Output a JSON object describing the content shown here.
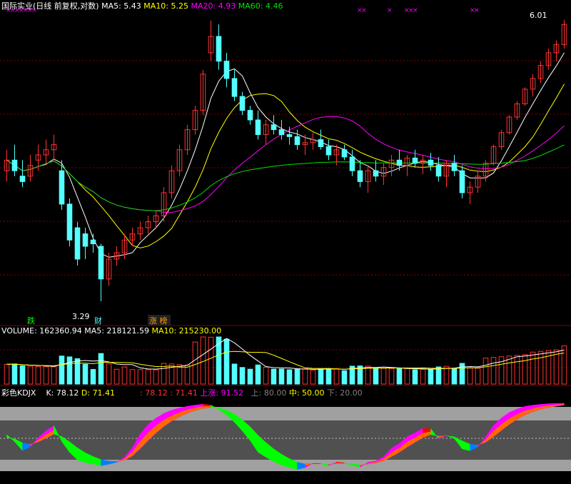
{
  "price_header": {
    "title": "国际实业(日线 前复权,对数)",
    "ma5": "MA5: 5.43",
    "ma10": "MA10: 5.25",
    "ma20": "MA20: 4.93",
    "ma60": "MA60: 4.46"
  },
  "price_markers": {
    "high_label": "6.01",
    "low_label": "3.29",
    "tag_die": "跌",
    "tag_cai": "财",
    "tag_zhangbang": "涨 榜"
  },
  "volume_header": {
    "volume": "VOLUME: 162360.94",
    "ma5": "MA5: 218121.59",
    "ma10": "MA10: 215230.00"
  },
  "kdj_header": {
    "name": "彩色KDJX",
    "k": "K: 78.12",
    "d": "D: 71.41",
    "vals": ": 78.12 : 71.41",
    "up": "上涨: 91.52",
    "upper": "上: 80.00",
    "mid": "中: 50.00",
    "lower": "下: 20.00"
  },
  "colors": {
    "up": "#ff3232",
    "down": "#54ffff",
    "ma5": "#ffffff",
    "ma10": "#ffff00",
    "ma20": "#ff00ff",
    "ma60": "#00e000",
    "grid": "#8b0000",
    "kdj_magenta": "#ff00ff",
    "kdj_red": "#ff0000",
    "kdj_orange": "#ff6a00",
    "kdj_blue": "#0080ff",
    "kdj_green": "#00ff00",
    "kdj_band": "#a0a0a0",
    "kdj_core": "#505050"
  },
  "chart_data": {
    "type": "candlestick",
    "title": "国际实业(日线 前复权,对数)",
    "scale": "log",
    "ylim": [
      3.2,
      6.1
    ],
    "candles": [
      [
        4.35,
        4.55,
        4.25,
        4.45
      ],
      [
        4.45,
        4.6,
        4.3,
        4.35
      ],
      [
        4.3,
        4.45,
        4.2,
        4.25
      ],
      [
        4.3,
        4.5,
        4.25,
        4.4
      ],
      [
        4.45,
        4.6,
        4.35,
        4.5
      ],
      [
        4.5,
        4.65,
        4.4,
        4.55
      ],
      [
        4.55,
        4.7,
        4.45,
        4.6
      ],
      [
        4.35,
        4.45,
        4.0,
        4.05
      ],
      [
        4.05,
        4.1,
        3.7,
        3.75
      ],
      [
        3.85,
        3.9,
        3.55,
        3.6
      ],
      [
        3.8,
        3.85,
        3.6,
        3.7
      ],
      [
        3.75,
        3.8,
        3.65,
        3.72
      ],
      [
        3.7,
        3.72,
        3.29,
        3.45
      ],
      [
        3.45,
        3.65,
        3.4,
        3.6
      ],
      [
        3.6,
        3.7,
        3.55,
        3.65
      ],
      [
        3.65,
        3.8,
        3.6,
        3.75
      ],
      [
        3.75,
        3.85,
        3.7,
        3.8
      ],
      [
        3.8,
        3.9,
        3.75,
        3.85
      ],
      [
        3.85,
        3.95,
        3.8,
        3.9
      ],
      [
        3.9,
        4.0,
        3.85,
        3.95
      ],
      [
        3.95,
        4.2,
        3.9,
        4.15
      ],
      [
        4.15,
        4.4,
        4.1,
        4.35
      ],
      [
        4.35,
        4.6,
        4.3,
        4.55
      ],
      [
        4.55,
        4.8,
        4.5,
        4.75
      ],
      [
        4.75,
        5.0,
        4.7,
        4.95
      ],
      [
        4.95,
        5.4,
        4.9,
        5.35
      ],
      [
        5.6,
        6.0,
        5.5,
        5.8
      ],
      [
        5.8,
        5.95,
        5.4,
        5.5
      ],
      [
        5.5,
        5.6,
        5.2,
        5.3
      ],
      [
        5.3,
        5.4,
        5.05,
        5.1
      ],
      [
        5.1,
        5.15,
        4.9,
        4.95
      ],
      [
        4.95,
        5.0,
        4.8,
        4.85
      ],
      [
        4.85,
        4.95,
        4.65,
        4.7
      ],
      [
        4.7,
        4.85,
        4.6,
        4.8
      ],
      [
        4.8,
        4.9,
        4.7,
        4.75
      ],
      [
        4.75,
        4.85,
        4.65,
        4.7
      ],
      [
        4.7,
        4.78,
        4.6,
        4.68
      ],
      [
        4.68,
        4.75,
        4.55,
        4.6
      ],
      [
        4.6,
        4.7,
        4.5,
        4.62
      ],
      [
        4.62,
        4.72,
        4.55,
        4.65
      ],
      [
        4.65,
        4.75,
        4.55,
        4.58
      ],
      [
        4.58,
        4.65,
        4.45,
        4.5
      ],
      [
        4.5,
        4.6,
        4.4,
        4.55
      ],
      [
        4.55,
        4.6,
        4.45,
        4.48
      ],
      [
        4.48,
        4.55,
        4.3,
        4.35
      ],
      [
        4.35,
        4.45,
        4.2,
        4.25
      ],
      [
        4.25,
        4.4,
        4.15,
        4.35
      ],
      [
        4.35,
        4.45,
        4.25,
        4.3
      ],
      [
        4.3,
        4.42,
        4.22,
        4.38
      ],
      [
        4.38,
        4.5,
        4.3,
        4.45
      ],
      [
        4.45,
        4.55,
        4.35,
        4.4
      ],
      [
        4.4,
        4.5,
        4.3,
        4.47
      ],
      [
        4.47,
        4.55,
        4.38,
        4.42
      ],
      [
        4.42,
        4.5,
        4.32,
        4.45
      ],
      [
        4.45,
        4.52,
        4.35,
        4.4
      ],
      [
        4.4,
        4.48,
        4.25,
        4.3
      ],
      [
        4.3,
        4.45,
        4.2,
        4.42
      ],
      [
        4.42,
        4.5,
        4.3,
        4.35
      ],
      [
        4.35,
        4.4,
        4.1,
        4.15
      ],
      [
        4.15,
        4.25,
        4.05,
        4.2
      ],
      [
        4.2,
        4.35,
        4.15,
        4.3
      ],
      [
        4.3,
        4.45,
        4.25,
        4.42
      ],
      [
        4.42,
        4.6,
        4.4,
        4.58
      ],
      [
        4.58,
        4.75,
        4.55,
        4.72
      ],
      [
        4.72,
        4.9,
        4.7,
        4.88
      ],
      [
        4.88,
        5.05,
        4.85,
        5.02
      ],
      [
        5.02,
        5.2,
        5.0,
        5.18
      ],
      [
        5.18,
        5.35,
        5.1,
        5.3
      ],
      [
        5.3,
        5.5,
        5.25,
        5.45
      ],
      [
        5.45,
        5.65,
        5.4,
        5.6
      ],
      [
        5.6,
        5.75,
        5.5,
        5.7
      ],
      [
        5.7,
        6.01,
        5.65,
        5.95
      ]
    ]
  }
}
